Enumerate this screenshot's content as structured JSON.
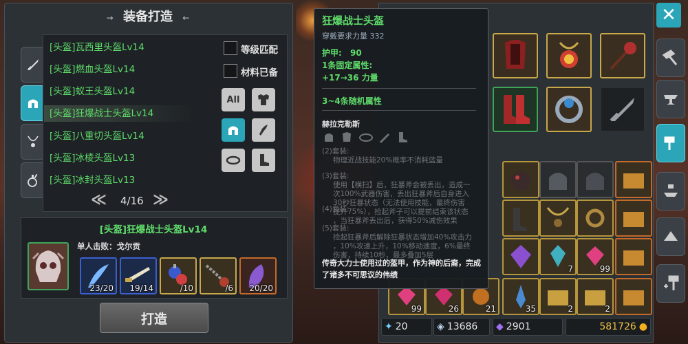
{
  "panel": {
    "title": "装备打造",
    "title_left_deco": "→",
    "title_right_deco": "←"
  },
  "side_tabs": [
    {
      "icon": "sword-icon"
    },
    {
      "icon": "helmet-icon",
      "active": true
    },
    {
      "icon": "necklace-icon"
    },
    {
      "icon": "potion-icon"
    }
  ],
  "recipe_list": [
    "[头盔]瓦西里头盔Lv14",
    "[头盔]燃血头盔Lv14",
    "[头盔]蚁王头盔Lv14",
    "[头盔]狂爆战士头盔Lv14",
    "[头盔]八重切头盔Lv14",
    "[头盔]冰棱头盔Lv13",
    "[头盔]冰封头盔Lv13"
  ],
  "selected_index": 3,
  "filters": {
    "level_match": "等级匹配",
    "material_ready": "材料已备",
    "all_label": "All"
  },
  "pager": {
    "text": "4/16"
  },
  "recipe": {
    "title": "[头盔]狂爆战士头盔Lv14",
    "kill_label": "单人击败：戈尔贡",
    "materials": [
      {
        "name": "feather",
        "count": "23/20",
        "border": "#3c5fd0"
      },
      {
        "name": "blade",
        "count": "19/14",
        "border": "#3c5fd0"
      },
      {
        "name": "potion-bundle",
        "count": "/10",
        "border": "#c8a84b"
      },
      {
        "name": "chain",
        "count": "/6",
        "border": "#c8a84b"
      },
      {
        "name": "purple-leaf",
        "count": "20/20",
        "border": "#c46a2a"
      }
    ]
  },
  "craft_button": "打造",
  "tooltip": {
    "name": "狂爆战士头盔",
    "requirement": "穿戴要求力量 332",
    "armor_label": "护甲:",
    "armor_value": "90",
    "fixed_attr_label": "1条固定属性:",
    "fixed_attr_value": "+17→36  力量",
    "random_attr": "3~4条随机属性",
    "set_name": "赫拉克勒斯",
    "set_bonus_2": [
      "(2)套装:",
      "物理近战技能20%概率不消耗蓝量"
    ],
    "set_bonus_3": [
      "(3)套装:",
      "使用【横扫】后，狂暴斧会被丢出，造成一",
      "次100%武器伤害，丢出狂暴斧后自身进入",
      "30秒狂暴状态（无法使用技能，最终伤害",
      "提升75%），捡起斧子可以提前结束该状态",
      "，当狂暴斧丢出后，获得50%减伤效果"
    ],
    "set_bonus_5": [
      "(5)套装:",
      "捡起狂暴斧后解除狂暴状态增加40%攻击力",
      "，10%攻速上升，10%移动速度，6%最终",
      "伤害，持续10秒，最多叠加5层"
    ],
    "set_bonus_4_label": "(4)套装:",
    "flavor": "传奇大力士使用过的盔甲，作为神的后裔，完成了诸多不可思议的伟绩"
  },
  "equipment": [
    {
      "name": "red-armor",
      "border": "gold"
    },
    {
      "name": "fire-amulet",
      "border": "gold"
    },
    {
      "name": "spiked-mace",
      "border": "gold"
    },
    {
      "name": "red-boots",
      "border": "green"
    },
    {
      "name": "blue-ring",
      "border": "gold"
    },
    {
      "name": "sword-placeholder",
      "border": "dark"
    }
  ],
  "inventory_counts": {
    "r4c2": "7",
    "r4c3": "99",
    "r5c1": "99",
    "r5c2": "26",
    "r5c3": "21",
    "r5c4": "35",
    "r5c5": "2",
    "r5c6": "2"
  },
  "currency": {
    "crystal": "20",
    "gem": "13686",
    "purple_gem": "2901",
    "gold": "581726"
  },
  "colors": {
    "accent": "#2aa6b8",
    "item_green": "#5fdc6a",
    "gold_border": "#c8a84b"
  }
}
